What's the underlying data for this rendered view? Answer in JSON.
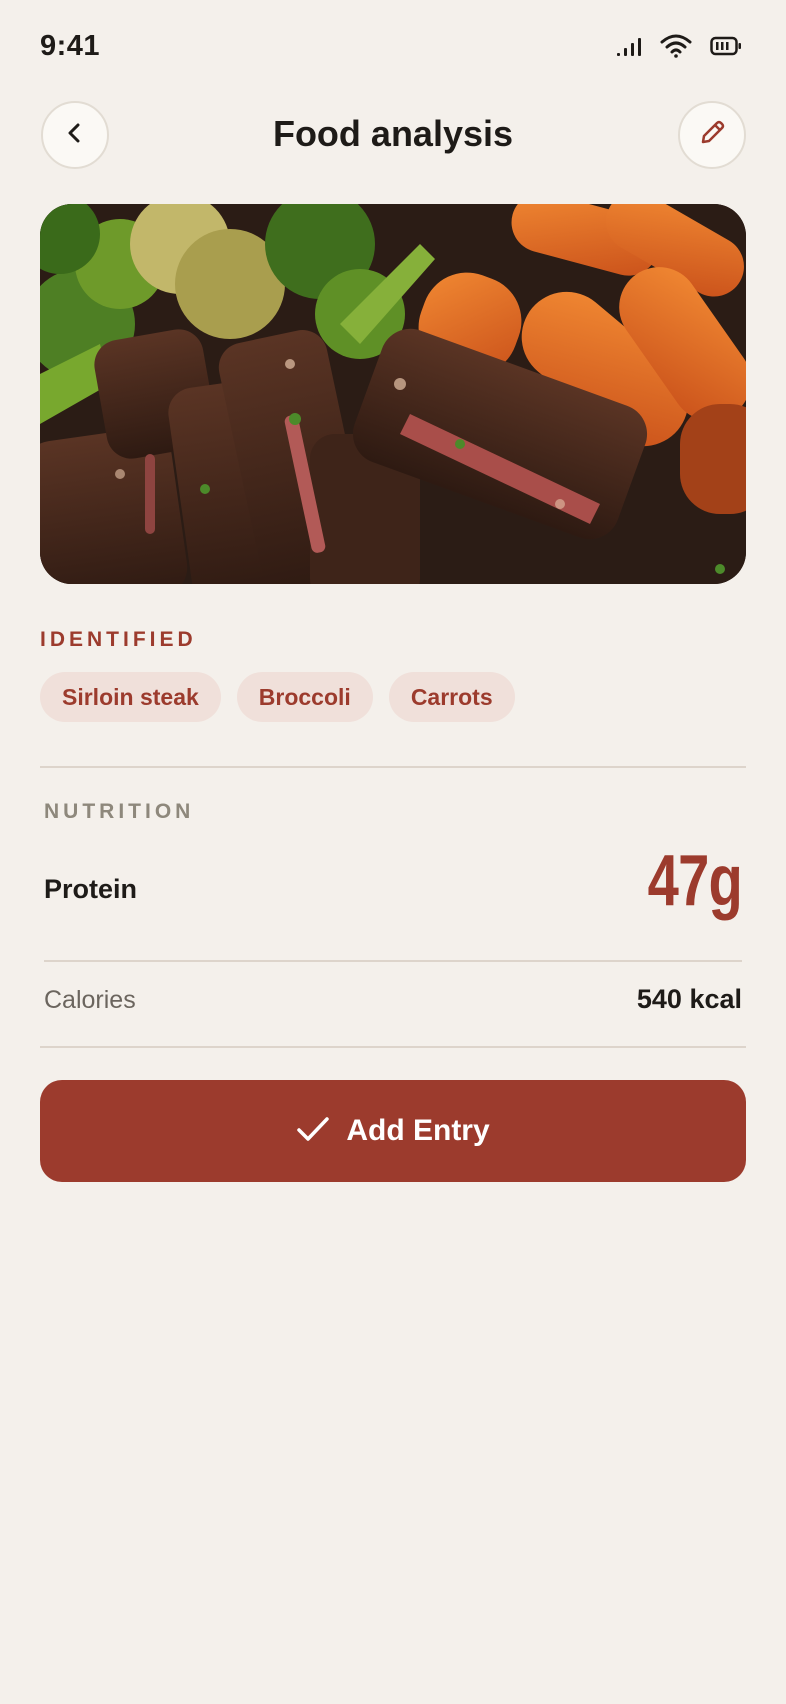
{
  "status_bar": {
    "time": "9:41"
  },
  "header": {
    "title": "Food analysis"
  },
  "icons": {
    "back": "chevron-left-icon",
    "edit": "pencil-icon",
    "confirm": "check-icon",
    "signal": "cellular-signal-icon",
    "wifi": "wifi-icon",
    "battery": "battery-icon"
  },
  "photo": {
    "subject": "food-photo"
  },
  "identified": {
    "label": "IDENTIFIED",
    "items": [
      "Sirloin steak",
      "Broccoli",
      "Carrots"
    ]
  },
  "nutrition": {
    "label": "NUTRITION",
    "protein": {
      "label": "Protein",
      "value": "47g"
    },
    "calories": {
      "label": "Calories",
      "value": "540 kcal"
    }
  },
  "actions": {
    "add_entry": "Add Entry"
  },
  "colors": {
    "background": "#F4F0EB",
    "accent": "#9C3B2D",
    "chip_bg": "#F0E0DA",
    "muted_text": "#8E887C",
    "divider": "#DDD4CB"
  }
}
